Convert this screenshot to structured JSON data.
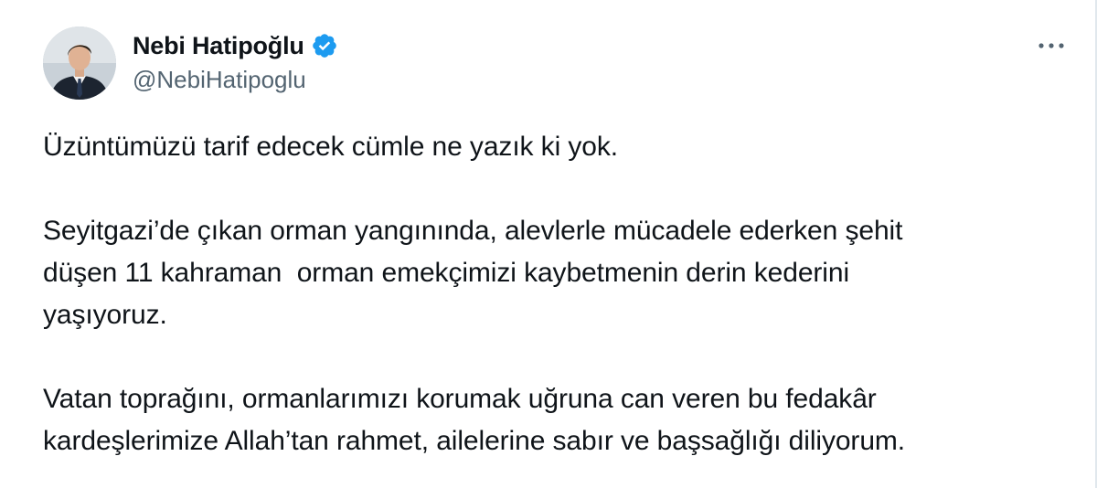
{
  "author": {
    "display_name": "Nebi Hatipoğlu",
    "handle": "@NebiHatipoglu",
    "verified": true,
    "verified_color": "#1d9bf0"
  },
  "actions": {
    "more_icon": "more-horizontal-icon"
  },
  "tweet": {
    "paragraphs": [
      "Üzüntümüzü tarif edecek cümle ne yazık ki yok.",
      "Seyitgazi’de çıkan orman yangınında, alevlerle mücadele ederken şehit\ndüşen 11 kahraman  orman emekçimizi kaybetmenin derin kederini\nyaşıyoruz.",
      "Vatan toprağını, ormanlarımızı korumak uğruna can veren bu fedakâr\nkardeşlerimize Allah’tan rahmet, ailelerine sabır ve başsağlığı diliyorum."
    ]
  }
}
